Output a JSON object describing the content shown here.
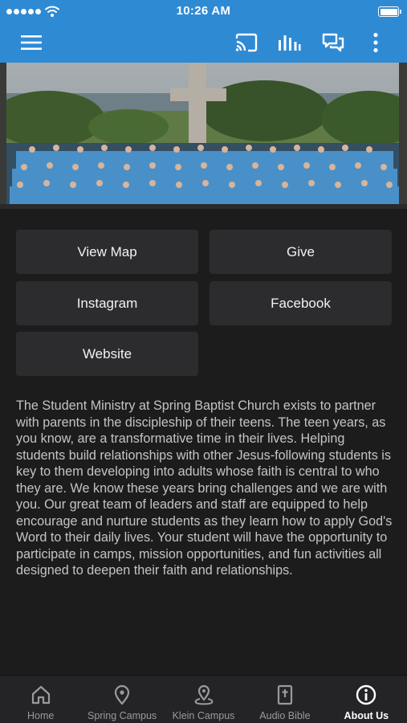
{
  "status_bar": {
    "time": "10:26 AM"
  },
  "app_bar": {
    "icons": [
      "menu-icon",
      "cast-icon",
      "audio-bars-icon",
      "chat-icon",
      "more-vertical-icon"
    ],
    "color": "#2f8ad4"
  },
  "hero": {
    "icon": "group-photo-image"
  },
  "buttons": {
    "view_map": "View Map",
    "give": "Give",
    "instagram": "Instagram",
    "facebook": "Facebook",
    "website": "Website"
  },
  "description": "The Student Ministry at Spring Baptist Church exists to partner with parents in the discipleship of their teens. The teen years, as you know, are a transformative time in their lives. Helping students build relationships with other Jesus-following students is key to them developing into adults whose faith is central to who they are. We know these years bring challenges and we are with you. Our great team of leaders and staff are equipped to help encourage and nurture students as they learn how to apply God's Word to their daily lives. Your student will have the opportunity to participate in camps, mission opportunities, and fun activities all designed to deepen their faith and relationships.",
  "tabs": {
    "home": "Home",
    "spring_campus": "Spring Campus",
    "klein_campus": "Klein Campus",
    "audio_bible": "Audio Bible",
    "about_us": "About Us",
    "active": "About Us"
  },
  "colors": {
    "accent": "#2f8ad4",
    "background": "#1c1c1d",
    "tile": "#2c2c2e"
  }
}
